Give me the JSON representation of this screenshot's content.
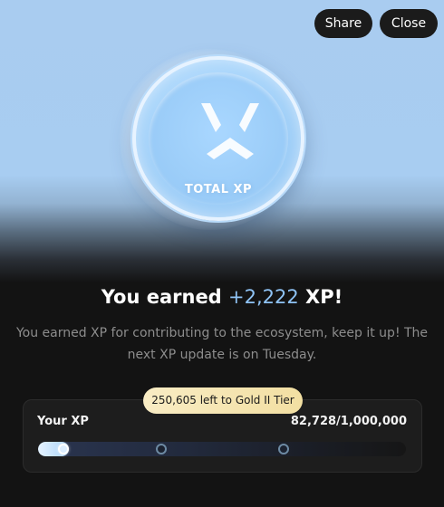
{
  "buttons": {
    "share": "Share",
    "close": "Close"
  },
  "coin": {
    "label": "TOTAL XP",
    "icon": "total-xp-logo-icon"
  },
  "headline": {
    "prefix": "You earned ",
    "amount": "+2,222",
    "suffix": " XP!"
  },
  "subtext": "You earned XP for contributing to the ecosystem, keep it up! The next XP update is on Tuesday.",
  "progress": {
    "tier_note": "250,605 left to Gold II Tier",
    "label": "Your XP",
    "value_text": "82,728/1,000,000",
    "current": 82728,
    "max": 1000000,
    "milestone_markers": 2
  },
  "colors": {
    "accent_amount": "#8fc3f5",
    "tier_pill": "#f5e4ad",
    "background": "#131313",
    "hero_sky": "#a8cdf1"
  }
}
